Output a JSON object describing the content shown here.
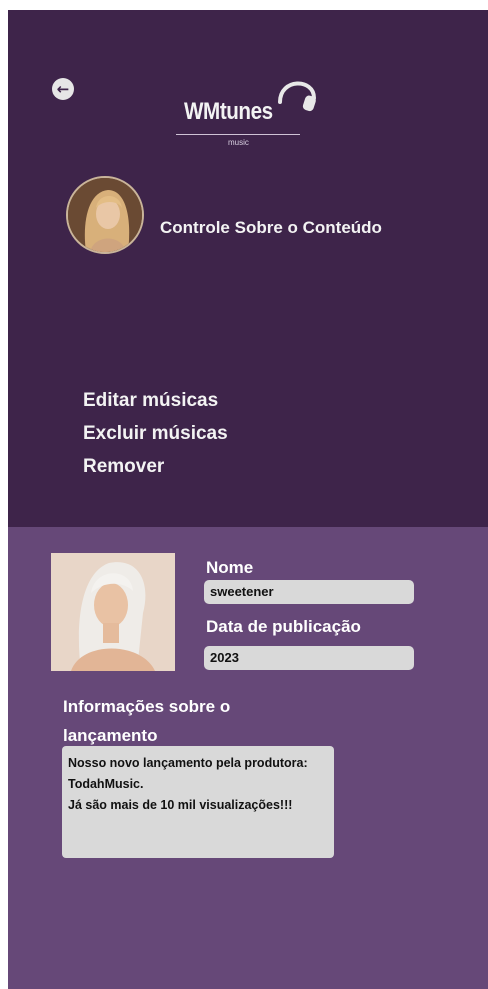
{
  "header": {
    "logo_text": "WMtunes",
    "logo_subtitle": "music",
    "page_title": "Controle Sobre o Conteúdo"
  },
  "menu": {
    "items": [
      {
        "label": "Editar músicas"
      },
      {
        "label": "Excluir músicas"
      },
      {
        "label": "Remover"
      }
    ]
  },
  "form": {
    "name_label": "Nome",
    "name_value": "sweetener",
    "date_label": "Data de publicação",
    "date_value": "2023",
    "info_label": "Informações sobre o lançamento",
    "info_value": "Nosso novo lançamento pela produtora: TodahMusic.\nJá são mais de 10 mil visualizações!!!"
  },
  "colors": {
    "top_bg": "#3e244a",
    "bottom_bg": "#664878",
    "field_bg": "#d9d9d9"
  },
  "icons": {
    "back": "arrow-left-icon",
    "logo": "headphones-icon"
  }
}
